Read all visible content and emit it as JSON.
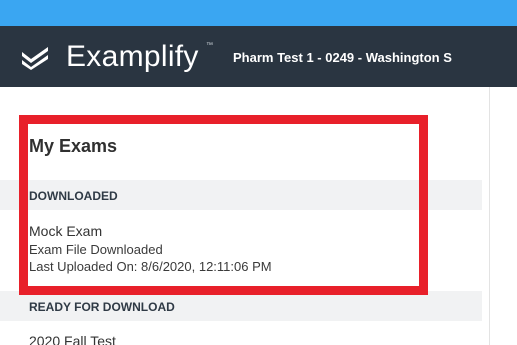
{
  "header": {
    "brand": "Examplify",
    "trademark": "™",
    "exam_title": "Pharm Test 1 - 0249 - Washington S",
    "logo_icon": "examplify-check-logo-icon"
  },
  "exams": {
    "heading": "My Exams",
    "downloaded_label": "DOWNLOADED",
    "downloaded_items": [
      {
        "name": "Mock Exam",
        "status": "Exam File Downloaded",
        "last_uploaded": "Last Uploaded On: 8/6/2020, 12:11:06 PM"
      }
    ],
    "ready_label": "READY FOR DOWNLOAD",
    "ready_items": [
      {
        "name": "2020 Fall Test"
      }
    ]
  },
  "colors": {
    "top_strip": "#3aa6f2",
    "header_bg": "#2a3541",
    "highlight": "#e8202a"
  }
}
